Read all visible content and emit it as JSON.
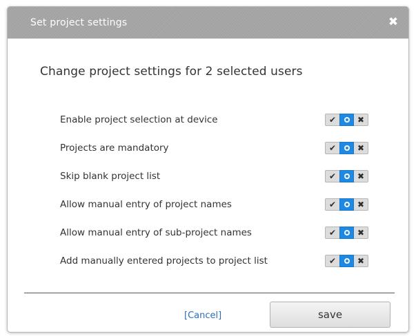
{
  "dialog": {
    "title": "Set project settings",
    "close_glyph": "✖",
    "heading": "Change project settings for 2 selected users"
  },
  "options": [
    {
      "label": "Enable project selection at device",
      "state": "unset"
    },
    {
      "label": "Projects are mandatory",
      "state": "unset"
    },
    {
      "label": "Skip blank project list",
      "state": "unset"
    },
    {
      "label": "Allow manual entry of project names",
      "state": "unset"
    },
    {
      "label": "Allow manual entry of sub-project names",
      "state": "unset"
    },
    {
      "label": "Add manually entered projects to project list",
      "state": "unset"
    }
  ],
  "toggle_icons": {
    "yes": "check-icon",
    "unset": "circle-icon",
    "no": "x-icon"
  },
  "footer": {
    "cancel_label": "[Cancel]",
    "save_label": "save"
  },
  "colors": {
    "title_bar": "#a3a3a3",
    "selected_segment": "#1e88e5",
    "link": "#2b6fb6"
  }
}
